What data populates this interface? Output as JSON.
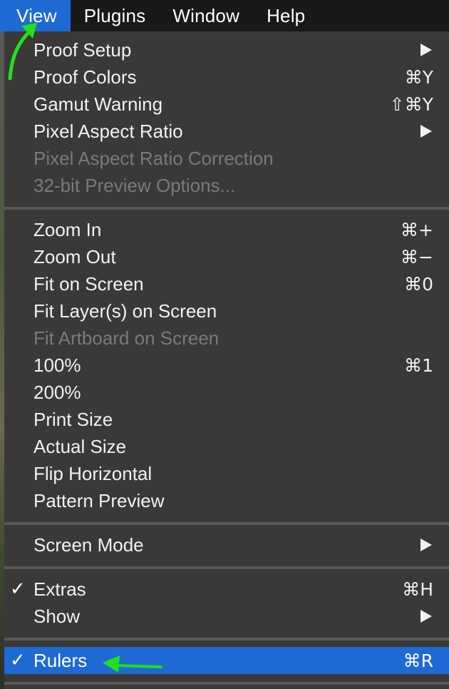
{
  "menubar": {
    "items": [
      {
        "label": "View"
      },
      {
        "label": "Plugins"
      },
      {
        "label": "Window"
      },
      {
        "label": "Help"
      }
    ]
  },
  "menu": {
    "items": [
      {
        "label": "Proof Setup",
        "shortcut": "",
        "submenu": true,
        "enabled": true
      },
      {
        "label": "Proof Colors",
        "shortcut": "⌘Y",
        "submenu": false,
        "enabled": true
      },
      {
        "label": "Gamut Warning",
        "shortcut": "⇧⌘Y",
        "submenu": false,
        "enabled": true
      },
      {
        "label": "Pixel Aspect Ratio",
        "shortcut": "",
        "submenu": true,
        "enabled": true
      },
      {
        "label": "Pixel Aspect Ratio Correction",
        "shortcut": "",
        "submenu": false,
        "enabled": false
      },
      {
        "label": "32-bit Preview Options...",
        "shortcut": "",
        "submenu": false,
        "enabled": false
      },
      {
        "label": "Zoom In",
        "shortcut": "⌘+",
        "submenu": false,
        "enabled": true
      },
      {
        "label": "Zoom Out",
        "shortcut": "⌘−",
        "submenu": false,
        "enabled": true
      },
      {
        "label": "Fit on Screen",
        "shortcut": "⌘0",
        "submenu": false,
        "enabled": true
      },
      {
        "label": "Fit Layer(s) on Screen",
        "shortcut": "",
        "submenu": false,
        "enabled": true
      },
      {
        "label": "Fit Artboard on Screen",
        "shortcut": "",
        "submenu": false,
        "enabled": false
      },
      {
        "label": "100%",
        "shortcut": "⌘1",
        "submenu": false,
        "enabled": true
      },
      {
        "label": "200%",
        "shortcut": "",
        "submenu": false,
        "enabled": true
      },
      {
        "label": "Print Size",
        "shortcut": "",
        "submenu": false,
        "enabled": true
      },
      {
        "label": "Actual Size",
        "shortcut": "",
        "submenu": false,
        "enabled": true
      },
      {
        "label": "Flip Horizontal",
        "shortcut": "",
        "submenu": false,
        "enabled": true
      },
      {
        "label": "Pattern Preview",
        "shortcut": "",
        "submenu": false,
        "enabled": true
      },
      {
        "label": "Screen Mode",
        "shortcut": "",
        "submenu": true,
        "enabled": true
      },
      {
        "label": "Extras",
        "shortcut": "⌘H",
        "submenu": false,
        "enabled": true,
        "checked": true
      },
      {
        "label": "Show",
        "shortcut": "",
        "submenu": true,
        "enabled": true
      },
      {
        "label": "Rulers",
        "shortcut": "⌘R",
        "submenu": false,
        "enabled": true,
        "checked": true,
        "highlighted": true
      }
    ],
    "check_glyph": "✓"
  },
  "colors": {
    "menubar_bg": "#19191b",
    "highlight": "#1f69d4",
    "menu_bg": "#3a3938",
    "disabled_text": "#7b7a78",
    "annotation_arrow": "#22e01a"
  },
  "annotations": [
    {
      "type": "arrow",
      "color": "#22e01a",
      "points_to": "View"
    },
    {
      "type": "arrow",
      "color": "#22e01a",
      "points_to": "Rulers"
    }
  ]
}
